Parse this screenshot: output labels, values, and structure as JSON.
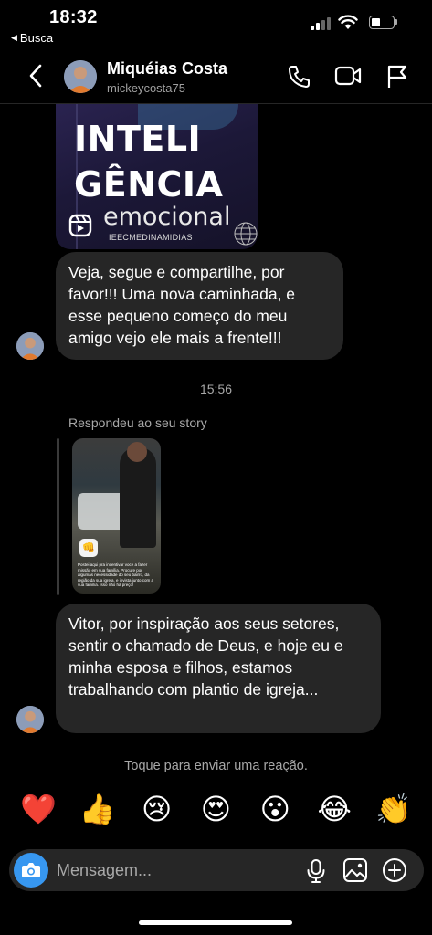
{
  "status_bar": {
    "time": "18:32",
    "back_app": "Busca"
  },
  "header": {
    "name": "Miquéias Costa",
    "username": "mickeycosta75",
    "icons": [
      "back-chevron-icon",
      "phone-icon",
      "video-camera-icon",
      "flag-icon"
    ]
  },
  "shared_reel": {
    "line1": "INTELI",
    "line2": "GÊNCIA",
    "line3": "emocional",
    "handle": "IEECMEDINAMIDIAS"
  },
  "messages": {
    "first": "Veja, segue e compartilhe, por favor!!! Uma nova caminhada,  e esse pequeno começo do meu amigo vejo ele mais a frente!!!",
    "timestamp": "15:56",
    "replied_label": "Respondeu ao seu story",
    "story_caption": "Postei aqui pra incentivar voce a fazer missão em sua família. Procure por algumas necessidade do seu bairro, da região da sua igreja, e invista junto com a sua família. Isso não há preço!",
    "second": "Vitor, por inspiração aos seus setores,  sentir o chamado de Deus, e hoje eu e minha esposa e filhos, estamos trabalhando com plantio de igreja..."
  },
  "reactions": {
    "hint": "Toque para enviar uma reação.",
    "items": [
      {
        "name": "red-heart",
        "glyph": "❤️"
      },
      {
        "name": "thumbs-up",
        "glyph": "👍"
      },
      {
        "name": "crying-face",
        "glyph": "😢"
      },
      {
        "name": "heart-eyes",
        "glyph": "😍"
      },
      {
        "name": "surprised-face",
        "glyph": "😮"
      },
      {
        "name": "tears-of-joy",
        "glyph": "😂"
      },
      {
        "name": "clapping-hands",
        "glyph": "👏"
      }
    ]
  },
  "composer": {
    "placeholder": "Mensagem...",
    "value": "",
    "icons": [
      "camera-icon",
      "microphone-icon",
      "gallery-icon",
      "plus-circle-icon"
    ]
  },
  "colors": {
    "background": "#000000",
    "bubble": "#262626",
    "secondary_text": "#a8a8a8",
    "camera_button": "#3797f0"
  }
}
